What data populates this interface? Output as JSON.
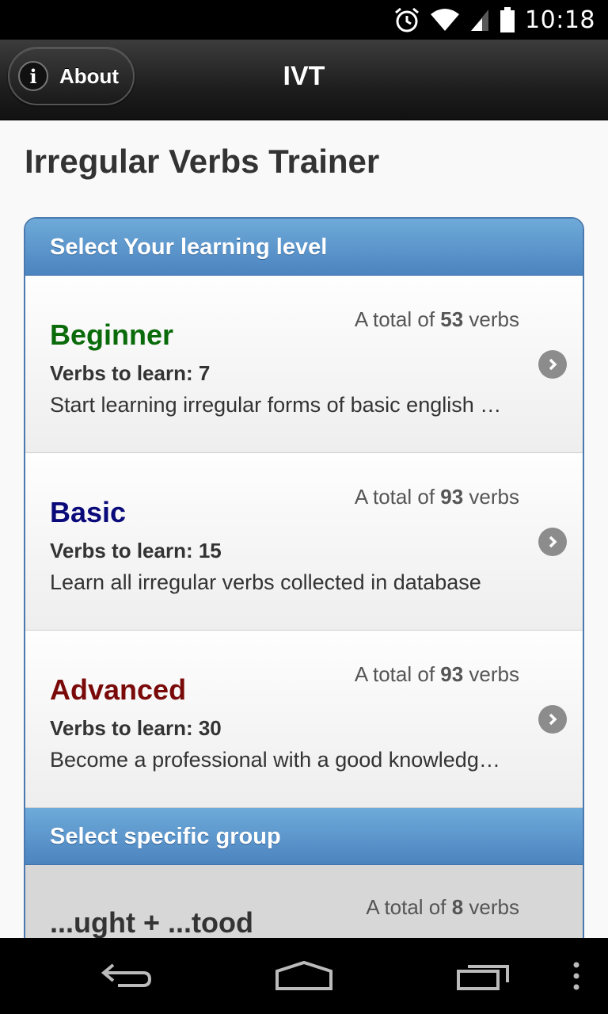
{
  "status_bar": {
    "time": "10:18",
    "icons": [
      "alarm-icon",
      "wifi-icon",
      "signal-icon",
      "battery-icon"
    ]
  },
  "header": {
    "about_label": "About",
    "title": "IVT"
  },
  "page_title": "Irregular Verbs Trainer",
  "levels": {
    "divider": "Select Your learning level",
    "items": [
      {
        "name": "Beginner",
        "color": "#0a6b0a",
        "count_prefix": "A total of ",
        "count": "53",
        "count_suffix": " verbs",
        "learn": "Verbs to learn: 7",
        "desc": "Start learning irregular forms of basic english …"
      },
      {
        "name": "Basic",
        "color": "#0a0a7a",
        "count_prefix": "A total of ",
        "count": "93",
        "count_suffix": " verbs",
        "learn": "Verbs to learn: 15",
        "desc": "Learn all irregular verbs collected in database"
      },
      {
        "name": "Advanced",
        "color": "#7a0a0a",
        "count_prefix": "A total of ",
        "count": "93",
        "count_suffix": " verbs",
        "learn": "Verbs to learn: 30",
        "desc": "Become a professional with a good knowledg…"
      }
    ]
  },
  "groups": {
    "divider": "Select specific group",
    "items": [
      {
        "name": "...ught + ...tood",
        "count_prefix": "A total of ",
        "count": "8",
        "count_suffix": " verbs"
      }
    ]
  },
  "nav_bar": {
    "icons": [
      "back-icon",
      "home-icon",
      "recent-apps-icon",
      "overflow-menu-icon"
    ]
  }
}
